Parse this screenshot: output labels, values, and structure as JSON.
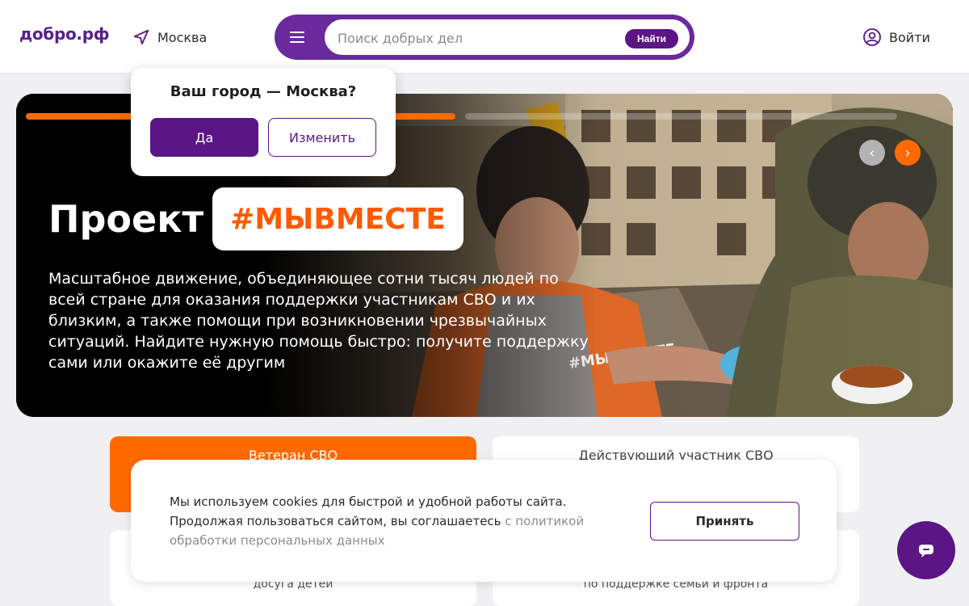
{
  "header": {
    "logo": "добро.рф",
    "city": "Москва",
    "search": {
      "placeholder": "Поиск добрых дел",
      "button": "Найти"
    },
    "login": "Войти"
  },
  "city_popup": {
    "question": "Ваш город — Москва?",
    "yes": "Да",
    "change": "Изменить"
  },
  "hero": {
    "title": "Проект",
    "tag": "#МЫВМЕСТЕ",
    "text": "Масштабное движение, объединяющее сотни тысяч людей по всей стране для оказания поддержки участникам СВО и их близким, а также помощи при возникновении чрезвычайных ситуаций. Найдите нужную помощь быстро: получите поддержку сами или окажите её другим",
    "slides_total": 2,
    "active_slide": 1
  },
  "categories": [
    {
      "label": "Ветеран СВО"
    },
    {
      "label": "Действующий участник СВО"
    },
    {
      "label": "досуга детей"
    },
    {
      "label": "по поддержке семьи и фронта"
    }
  ],
  "cookie": {
    "text": "Мы используем cookies для быстрой и удобной работы сайта. Продолжая пользоваться сайтом, вы соглашаетесь ",
    "link": "с политикой обработки персональных данных",
    "accept": "Принять"
  },
  "colors": {
    "brand_purple": "#5b1584",
    "accent_orange": "#ff6a00"
  }
}
